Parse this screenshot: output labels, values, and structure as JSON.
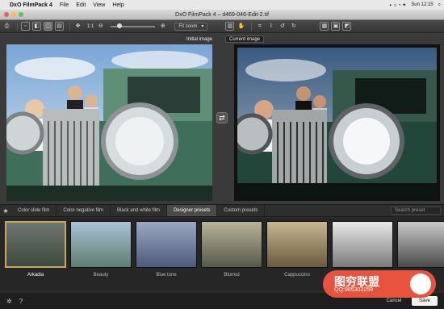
{
  "menubar": {
    "items": [
      "DxO FilmPack 4",
      "File",
      "Edit",
      "View",
      "Help"
    ],
    "right": [
      "Sun 12:15"
    ]
  },
  "window": {
    "title": "DxO FilmPack 4 – d469-046-Edit-2.tif"
  },
  "toolbar": {
    "zoom_label": "1:1",
    "zoom_level": 0.15,
    "fit_zoom": "Fit zoom"
  },
  "viewer": {
    "initial_label": "Initial image",
    "current_label": "Current image"
  },
  "presets": {
    "tabs": [
      "Color slide film",
      "Color negative film",
      "Black and white film",
      "Designer presets",
      "Custom presets"
    ],
    "active_tab": "Designer presets",
    "search_placeholder": "Search preset",
    "thumbs": [
      "Arkadia",
      "Beauty",
      "Blue tone",
      "Blurred",
      "Cappuccino",
      "",
      ""
    ],
    "selected": "Arkadia"
  },
  "footer": {
    "cancel": "Cancel",
    "save": "Save"
  },
  "watermark": {
    "line1": "图穷联盟",
    "line2": "QQ:985303259"
  },
  "colors": {
    "accent": "#c8a95c",
    "watermark": "#e9533e"
  }
}
